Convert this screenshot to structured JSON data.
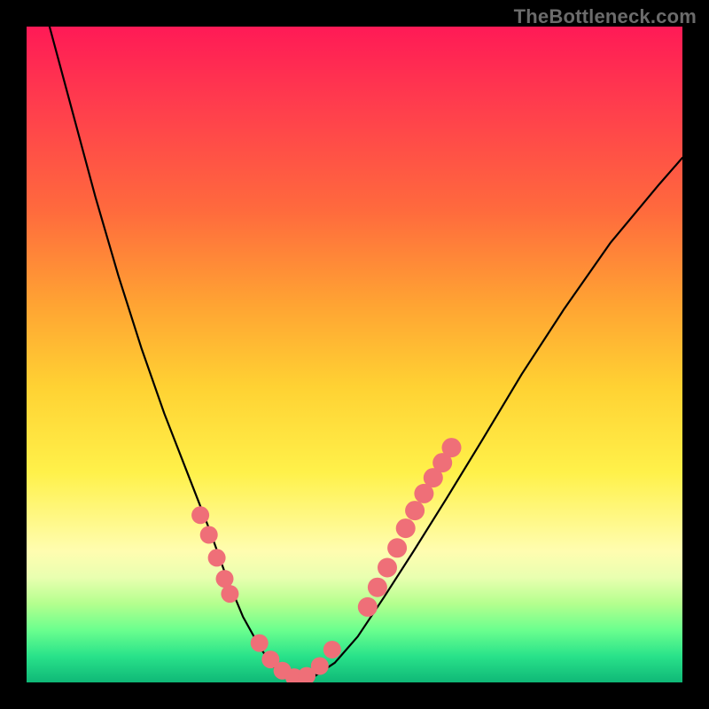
{
  "watermark": "TheBottleneck.com",
  "chart_data": {
    "type": "line",
    "title": "",
    "xlabel": "",
    "ylabel": "",
    "xlim": [
      0,
      1
    ],
    "ylim": [
      0,
      1
    ],
    "gradient_stops": [
      {
        "pos": 0.0,
        "color": "#ff1a56"
      },
      {
        "pos": 0.12,
        "color": "#ff3d4d"
      },
      {
        "pos": 0.28,
        "color": "#ff6a3d"
      },
      {
        "pos": 0.42,
        "color": "#ffa233"
      },
      {
        "pos": 0.55,
        "color": "#ffd233"
      },
      {
        "pos": 0.68,
        "color": "#fff14a"
      },
      {
        "pos": 0.8,
        "color": "#fffdb0"
      },
      {
        "pos": 0.84,
        "color": "#e9ffb0"
      },
      {
        "pos": 0.88,
        "color": "#b4ff8e"
      },
      {
        "pos": 0.92,
        "color": "#6bff8e"
      },
      {
        "pos": 0.96,
        "color": "#29e28a"
      },
      {
        "pos": 1.0,
        "color": "#0fb877"
      }
    ],
    "series": [
      {
        "name": "bottleneck-curve",
        "color": "#000000",
        "stroke_width": 2.2,
        "x": [
          0.035,
          0.07,
          0.105,
          0.14,
          0.175,
          0.21,
          0.245,
          0.28,
          0.305,
          0.33,
          0.355,
          0.375,
          0.395,
          0.415,
          0.44,
          0.47,
          0.505,
          0.545,
          0.59,
          0.64,
          0.695,
          0.755,
          0.82,
          0.89,
          0.965,
          1.0
        ],
        "y": [
          1.0,
          0.87,
          0.74,
          0.62,
          0.51,
          0.41,
          0.32,
          0.23,
          0.16,
          0.1,
          0.055,
          0.025,
          0.01,
          0.005,
          0.01,
          0.03,
          0.07,
          0.13,
          0.2,
          0.28,
          0.37,
          0.47,
          0.57,
          0.67,
          0.76,
          0.8
        ]
      },
      {
        "name": "bead-cluster-left",
        "type": "scatter",
        "color": "#ef6f78",
        "radius": 10,
        "x": [
          0.265,
          0.278,
          0.29,
          0.302,
          0.31
        ],
        "y": [
          0.255,
          0.225,
          0.19,
          0.158,
          0.135
        ]
      },
      {
        "name": "bead-cluster-bottom",
        "type": "scatter",
        "color": "#ef6f78",
        "radius": 10,
        "x": [
          0.355,
          0.372,
          0.39,
          0.408,
          0.427,
          0.447,
          0.466
        ],
        "y": [
          0.06,
          0.035,
          0.018,
          0.008,
          0.01,
          0.025,
          0.05
        ]
      },
      {
        "name": "bead-cluster-right",
        "type": "scatter",
        "color": "#ef6f78",
        "radius": 11,
        "x": [
          0.52,
          0.535,
          0.55,
          0.565,
          0.578,
          0.592,
          0.606,
          0.62,
          0.634,
          0.648
        ],
        "y": [
          0.115,
          0.145,
          0.175,
          0.205,
          0.235,
          0.262,
          0.288,
          0.312,
          0.335,
          0.358
        ]
      }
    ]
  }
}
